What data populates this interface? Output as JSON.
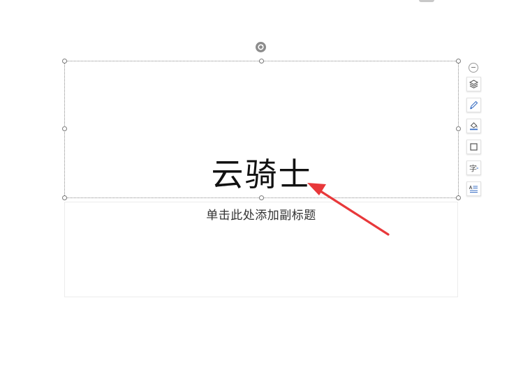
{
  "slide": {
    "title": "云骑士",
    "subtitle_placeholder": "单击此处添加副标题"
  },
  "toolbar": {
    "items": [
      {
        "name": "collapse-icon"
      },
      {
        "name": "layers-icon"
      },
      {
        "name": "pen-icon"
      },
      {
        "name": "fill-bucket-icon"
      },
      {
        "name": "border-square-icon"
      },
      {
        "name": "text-effect-icon"
      },
      {
        "name": "text-align-icon"
      }
    ],
    "text_effect_glyph": "字"
  },
  "annotation": {
    "arrow_color": "#e8383a"
  },
  "colors": {
    "selection_border": "#8a8a8a",
    "icon_blue": "#3a6fc4",
    "icon_gray": "#555555"
  }
}
